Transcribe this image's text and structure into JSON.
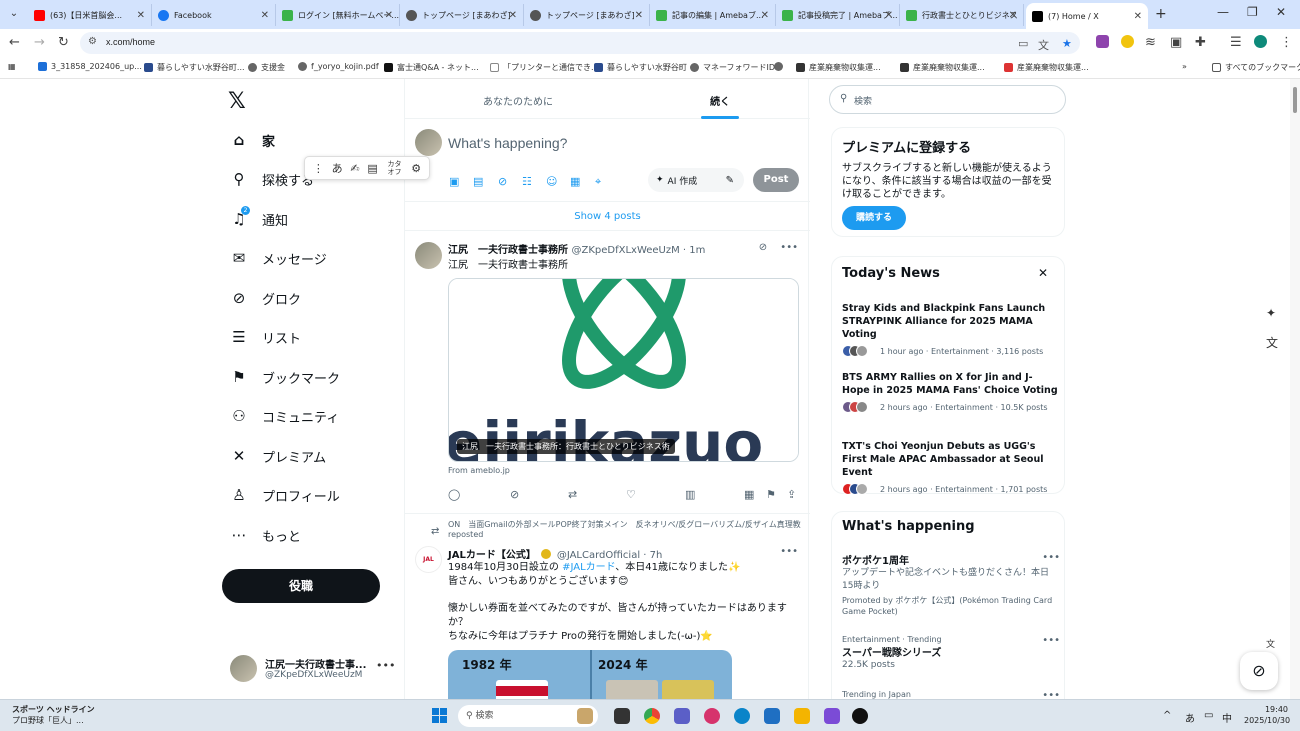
{
  "browser": {
    "tabs": [
      {
        "label": "(63)【日米首脳会...",
        "color": "#ff0000"
      },
      {
        "label": "Facebook",
        "color": "#1877f2"
      },
      {
        "label": "ログイン [無料ホームペー...",
        "color": "#3bb34a"
      },
      {
        "label": "トップページ [まあわざ]",
        "color": "#555555"
      },
      {
        "label": "トップページ [まあわざ]",
        "color": "#555555"
      },
      {
        "label": "記事の編集 | Amebaブ...",
        "color": "#3bb34a"
      },
      {
        "label": "記事投稿完了 | Amebaブ...",
        "color": "#3bb34a"
      },
      {
        "label": "行政書士とひとりビジネス",
        "color": "#3bb34a"
      },
      {
        "label": "(7) Home / X",
        "color": "#000000"
      }
    ],
    "url": "x.com/home",
    "bookmarks": [
      "3_31858_202406_up...",
      "暮らしやすい水野谷町...",
      "支援金",
      "f_yoryo_kojin.pdf",
      "富士通Q&A - ネット...",
      "「プリンターと通信でき...",
      "暮らしやすい水野谷町",
      "マネーフォワードID",
      "産業廃棄物収集運...",
      "産業廃棄物収集運...",
      "産業廃棄物収集運..."
    ],
    "all_bookmarks": "すべてのブックマーク"
  },
  "ime": {
    "items": [
      "あ",
      "カタ オフ"
    ]
  },
  "nav": {
    "items": [
      {
        "label": "家",
        "icon": "home-icon",
        "glyph": "⌂"
      },
      {
        "label": "探検する",
        "icon": "search-icon",
        "glyph": "⚲"
      },
      {
        "label": "通知",
        "icon": "bell-icon",
        "glyph": "♫"
      },
      {
        "label": "メッセージ",
        "icon": "mail-icon",
        "glyph": "✉"
      },
      {
        "label": "グロク",
        "icon": "grok-icon",
        "glyph": "⊘"
      },
      {
        "label": "リスト",
        "icon": "list-icon",
        "glyph": "☰"
      },
      {
        "label": "ブックマーク",
        "icon": "bookmark-icon",
        "glyph": "⚑"
      },
      {
        "label": "コミュニティ",
        "icon": "community-icon",
        "glyph": "⚇"
      },
      {
        "label": "プレミアム",
        "icon": "x-premium-icon",
        "glyph": "✕"
      },
      {
        "label": "プロフィール",
        "icon": "profile-icon",
        "glyph": "♙"
      },
      {
        "label": "もっと",
        "icon": "more-icon",
        "glyph": "⋯"
      }
    ],
    "notif_count": "2",
    "post_button": "役職",
    "account": {
      "name": "江尻一夫行政書士事...",
      "handle": "@ZKpeDfXLxWeeUzM"
    }
  },
  "feed": {
    "tab_for_you": "あなたのために",
    "tab_following": "続く",
    "composer_placeholder": "What's happening?",
    "ai_button": "AI 作成",
    "post_button": "Post",
    "show_posts": "Show 4 posts",
    "tweet1": {
      "name": "江尻　一夫行政書士事務所",
      "handle": "@ZKpeDfXLxWeeUzM · 1m",
      "subtitle": "江尻　一夫行政書士事務所",
      "card_caption": "江尻　一夫行政書士事務所：行政書士とひとりビジネス術",
      "card_brand": "eiirikazuo",
      "from": "From ameblo.jp"
    },
    "tweet2": {
      "repost_line": "ON　当面Gmailの外部メールPOP終了対策メイン　反ネオリベ/反グローバリズム/反ザイム真理教 reposted",
      "name": "JALカード【公式】",
      "handle": "@JALCardOfficial · 7h",
      "avatar_text": "JAL",
      "line1a": "1984年10月30日設立の ",
      "line1tag": "#JALカード",
      "line1b": "、本日41歳になりました✨",
      "line2": "皆さん、いつもありがとうございます😊",
      "line3": "懐かしい券面を並べてみたのですが、皆さんが持っていたカードはありますか？",
      "line4": "ちなみに今年はプラチナ Proの発行を開始しました(-ω-)⭐",
      "year1": "1982 年",
      "year2": "2024 年"
    }
  },
  "right": {
    "search_placeholder": "検索",
    "premium": {
      "title": "プレミアムに登録する",
      "text": "サブスクライブすると新しい機能が使えるようになり、条件に該当する場合は収益の一部を受け取ることができます。",
      "button": "購読する"
    },
    "news": {
      "title": "Today's News",
      "items": [
        {
          "headline": "Stray Kids and Blackpink Fans Launch STRAYPINK Alliance for 2025 MAMA Voting",
          "meta": "1 hour ago · Entertainment · 3,116 posts"
        },
        {
          "headline": "BTS ARMY Rallies on X for Jin and J-Hope in 2025 MAMA Fans' Choice Voting",
          "meta": "2 hours ago · Entertainment · 10.5K posts"
        },
        {
          "headline": "TXT's Choi Yeonjun Debuts as UGG's First Male APAC Ambassador at Seoul Event",
          "meta": "2 hours ago · Entertainment · 1,701 posts"
        }
      ]
    },
    "happening": {
      "title": "What's happening",
      "items": [
        {
          "title": "ポケポケ1周年",
          "sub": "アップデートや記念イベントも盛りだくさん！本日15時より",
          "promo": "Promoted by ポケポケ【公式】(Pokémon Trading Card Game Pocket)"
        },
        {
          "meta": "Entertainment · Trending",
          "title": "スーパー戦隊シリーズ",
          "sub": "22.5K posts"
        },
        {
          "meta": "Trending in Japan"
        }
      ]
    }
  },
  "taskbar": {
    "weather_title": "スポーツ ヘッドライン",
    "weather_sub": "プロ野球「巨人」...",
    "search": "検索",
    "ime_a": "あ",
    "ime_mode": "中",
    "time": "19:40",
    "date": "2025/10/30"
  }
}
